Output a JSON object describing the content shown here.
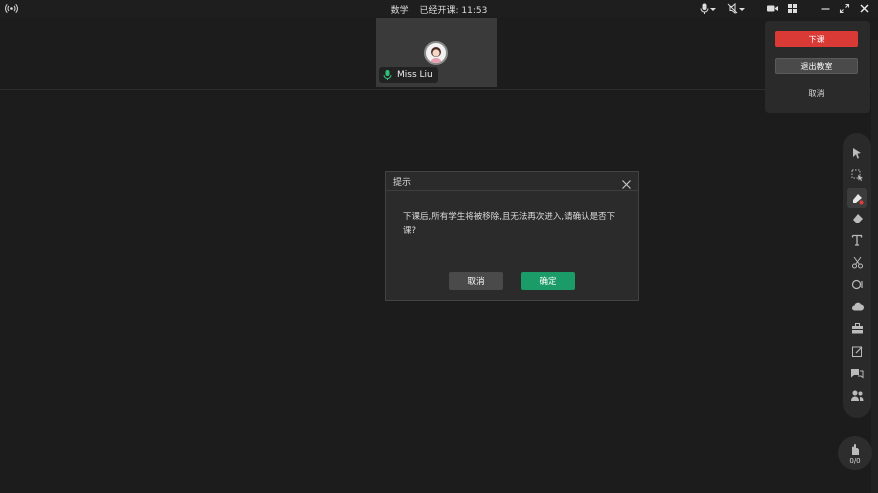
{
  "titlebar": {
    "subject": "数学",
    "status_label": "已经开课: 11:53"
  },
  "video": {
    "participant_name": "Miss Liu"
  },
  "end_menu": {
    "end_class_label": "下课",
    "exit_classroom_label": "退出教室",
    "cancel_label": "取消"
  },
  "dialog": {
    "title": "提示",
    "message": "下课后,所有学生将被移除,且无法再次进入,请确认是否下课?",
    "cancel_label": "取消",
    "confirm_label": "确定"
  },
  "raise_hand": {
    "count": "0/0"
  },
  "colors": {
    "danger": "#d93a35",
    "confirm": "#1a9b68",
    "secondary_button": "#4a4a4a",
    "mic_active": "#2fc17a"
  }
}
